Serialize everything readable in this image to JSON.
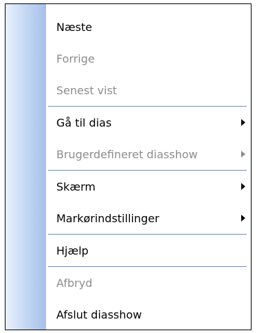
{
  "menu": {
    "items": [
      {
        "label": "Næste",
        "enabled": true,
        "submenu": false
      },
      {
        "label": "Forrige",
        "enabled": false,
        "submenu": false
      },
      {
        "label": "Senest vist",
        "enabled": false,
        "submenu": false
      },
      {
        "label": "Gå til dias",
        "enabled": true,
        "submenu": true
      },
      {
        "label": "Brugerdefineret diasshow",
        "enabled": false,
        "submenu": true
      },
      {
        "label": "Skærm",
        "enabled": true,
        "submenu": true
      },
      {
        "label": "Markørindstillinger",
        "enabled": true,
        "submenu": true
      },
      {
        "label": "Hjælp",
        "enabled": true,
        "submenu": false
      },
      {
        "label": "Afbryd",
        "enabled": false,
        "submenu": false
      },
      {
        "label": "Afslut diasshow",
        "enabled": true,
        "submenu": false
      }
    ],
    "colors": {
      "gutter": "#a6c0ea",
      "separator": "#6b8cc8",
      "disabled_text": "#8c8c8c"
    },
    "submenu_arrow_icon": "triangle-right-icon"
  }
}
